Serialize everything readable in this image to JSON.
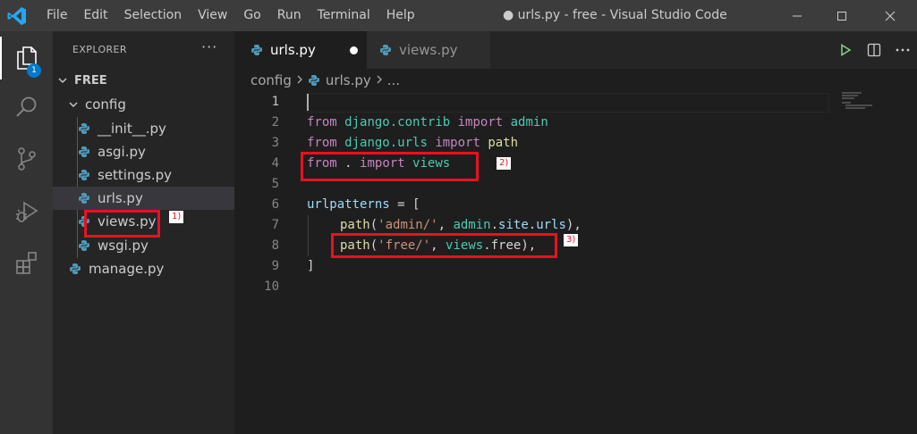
{
  "menu": [
    "File",
    "Edit",
    "Selection",
    "View",
    "Go",
    "Run",
    "Terminal",
    "Help"
  ],
  "window_title": "● urls.py - free - Visual Studio Code",
  "activity": {
    "badge": "1"
  },
  "explorer": {
    "header": "EXPLORER",
    "more": "···",
    "root": "FREE",
    "folder": "config",
    "files": [
      "__init__.py",
      "asgi.py",
      "settings.py",
      "urls.py",
      "views.py",
      "wsgi.py"
    ],
    "root_files": [
      "manage.py"
    ]
  },
  "tabs": [
    {
      "label": "urls.py",
      "modified": true,
      "active": true
    },
    {
      "label": "views.py",
      "modified": false,
      "active": false
    }
  ],
  "breadcrumbs": {
    "folder": "config",
    "file": "urls.py",
    "tail": "..."
  },
  "line_numbers": [
    "1",
    "2",
    "3",
    "4",
    "5",
    "6",
    "7",
    "8",
    "9",
    "10"
  ],
  "code": {
    "l2": {
      "a": "from",
      "b": "django.contrib",
      "c": "import",
      "d": "admin"
    },
    "l3": {
      "a": "from",
      "b": "django.urls",
      "c": "import",
      "d": "path"
    },
    "l4": {
      "a": "from",
      "b": ".",
      "c": "import",
      "d": "views"
    },
    "l6": {
      "a": "urlpatterns",
      "b": " = ["
    },
    "l7": {
      "a": "path",
      "b": "(",
      "c": "'admin/'",
      "d": ", ",
      "e": "admin",
      "f": ".",
      "g": "site",
      "h": ".",
      "i": "urls",
      "j": "),"
    },
    "l8": {
      "a": "path",
      "b": "(",
      "c": "'free/'",
      "d": ", ",
      "e": "views",
      "f": ".free),"
    },
    "l9": {
      "a": "]"
    }
  },
  "annotations": {
    "one": "1)",
    "two": "2)",
    "three": "3)"
  },
  "colors": {
    "annotation": "#e81123",
    "accent": "#007acc"
  }
}
